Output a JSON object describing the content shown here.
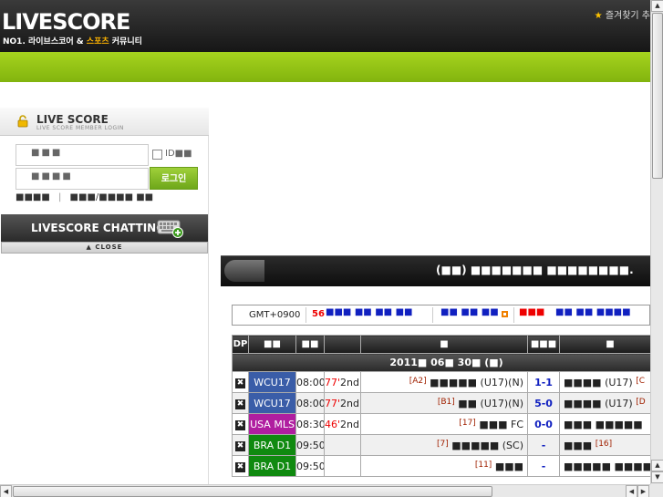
{
  "header": {
    "logo": "LIVESCORE",
    "tagline_prefix": "NO1. 라이브스코어 & ",
    "tagline_highlight": "스포츠",
    "tagline_suffix": " 커뮤니티",
    "favorite": "즐겨찾기 추"
  },
  "login": {
    "title": "LIVE SCORE",
    "subtitle": "LIVE SCORE MEMBER LOGIN",
    "id_placeholder": "■■■",
    "pw_placeholder": "■■■■",
    "remember_label": "ID■■",
    "button": "로그인",
    "link_join": "■■■■",
    "link_divider": "|",
    "link_find": "■■■/■■■■ ■■"
  },
  "chatting": {
    "label": "LIVESCORE CHATTING",
    "close": "▲ CLOSE"
  },
  "banner": {
    "text": "(■■) ■■■■■■■ ■■■■■■■■."
  },
  "gmt": {
    "zone": "GMT+0900",
    "live_count": "56",
    "blue_text_1": "■■■ ■■  ■■ ■■",
    "blue_text_2": "■■ ■■ ■■",
    "red_text": "■■■",
    "blue_text_3": "■■ ■■  ■■■■"
  },
  "table": {
    "headers": [
      "DP",
      "■■",
      "■■",
      "",
      "■",
      "■■■",
      "■"
    ],
    "date_text": "2011■ 06■ 30■ (■)",
    "rows": [
      {
        "league": "WCU17",
        "color": "#3a5da8",
        "time": "08:00",
        "minute": "77'",
        "period": "2nd",
        "home_rank": "[A2]",
        "home": "■■■■■ (U17)(N)",
        "score": "1-1",
        "away": "■■■■ (U17)",
        "away_rank": "[C"
      },
      {
        "league": "WCU17",
        "color": "#3a5da8",
        "time": "08:00",
        "minute": "77'",
        "period": "2nd",
        "home_rank": "[B1]",
        "home": "■■ (U17)(N)",
        "score": "5-0",
        "away": "■■■■ (U17)",
        "away_rank": "[D"
      },
      {
        "league": "USA MLS",
        "color": "#b01ea0",
        "time": "08:30",
        "minute": "46'",
        "period": "2nd",
        "home_rank": "[17]",
        "home": "■■■ FC",
        "score": "0-0",
        "away": "■■■ ■■■■■",
        "away_rank": ""
      },
      {
        "league": "BRA D1",
        "color": "#108a10",
        "time": "09:50",
        "minute": "",
        "period": "",
        "home_rank": "[7]",
        "home": "■■■■■ (SC)",
        "score": "-",
        "away": "■■■",
        "away_rank": "[16]"
      },
      {
        "league": "BRA D1",
        "color": "#108a10",
        "time": "09:50",
        "minute": "",
        "period": "",
        "home_rank": "[11]",
        "home": "■■■",
        "score": "-",
        "away": "■■■■■ ■■■■",
        "away_rank": ""
      }
    ]
  },
  "colors": {
    "green_bar": "#94c414",
    "score_blue": "#1020c0",
    "live_red": "#e00000"
  }
}
